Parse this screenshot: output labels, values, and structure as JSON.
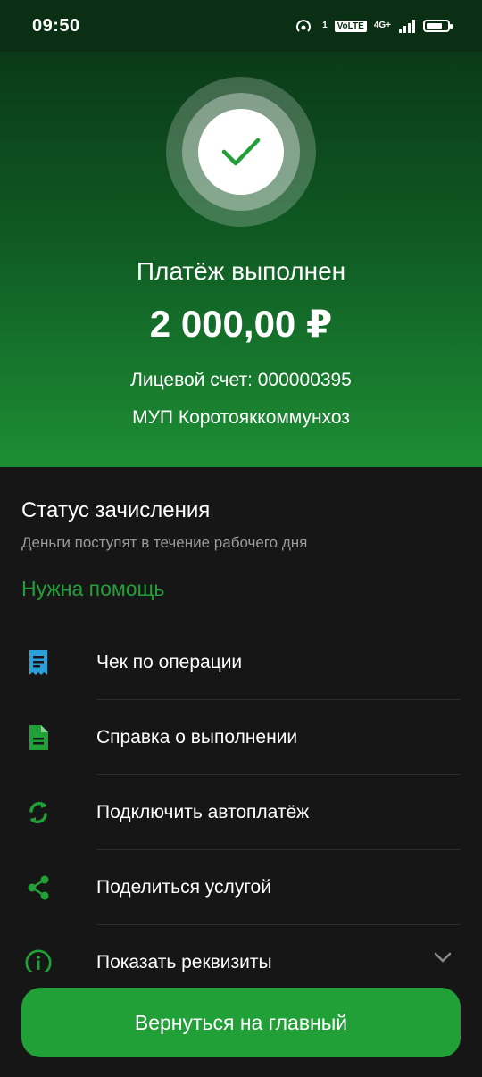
{
  "status_bar": {
    "time": "09:50",
    "hotspot_count": "1",
    "volte": "VoLTE",
    "network": "4G+",
    "battery_level": 0.75
  },
  "hero": {
    "title": "Платёж выполнен",
    "amount": "2 000,00 ₽",
    "account_line": "Лицевой счет: 000000395",
    "recipient": "МУП Коротояккоммунхоз",
    "accent_color": "#21a038"
  },
  "status": {
    "title": "Статус зачисления",
    "subtitle": "Деньги поступят в течение рабочего дня",
    "help_link": "Нужна помощь"
  },
  "menu": {
    "items": [
      {
        "label": "Чек по операции",
        "icon": "receipt-icon",
        "color": "#2a9fd8"
      },
      {
        "label": "Справка о выполнении",
        "icon": "document-icon",
        "color": "#21a038"
      },
      {
        "label": "Подключить автоплатёж",
        "icon": "autopay-icon",
        "color": "#21a038"
      },
      {
        "label": "Поделиться услугой",
        "icon": "share-icon",
        "color": "#21a038"
      },
      {
        "label": "Показать реквизиты",
        "icon": "info-icon",
        "color": "#21a038"
      }
    ]
  },
  "bottom": {
    "main_button": "Вернуться на главный"
  }
}
